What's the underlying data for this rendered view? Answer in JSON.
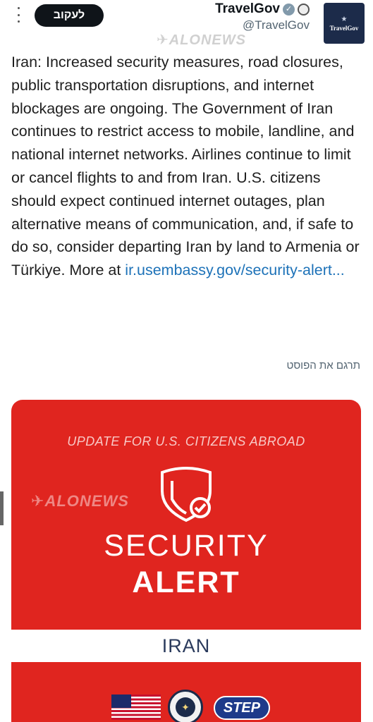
{
  "header": {
    "follow_label": "לעקוב",
    "display_name": "TravelGov",
    "handle": "@TravelGov",
    "avatar_label": "TravelGov",
    "avatar_star": "★"
  },
  "watermark": "ALONEWS",
  "tweet": {
    "body": "Iran: Increased security measures, road closures, public transportation disruptions, and internet blockages are ongoing. The Government of Iran continues to restrict access to mobile, landline, and national internet networks. Airlines continue to limit or cancel flights to and from Iran. U.S. citizens should expect continued internet outages, plan alternative means of communication, and, if safe to do so, consider departing Iran by land to Armenia or Türkiye. More at ",
    "link": "ir.usembassy.gov/security-alert...",
    "translate_label": "תרגם את הפוסט"
  },
  "card": {
    "subtitle": "UPDATE FOR U.S. CITIZENS ABROAD",
    "watermark": "ALONEWS",
    "title_line1": "SECURITY",
    "title_line2": "ALERT",
    "country": "IRAN",
    "step_label": "STEP",
    "seal_glyph": "✦",
    "colors": {
      "card_red": "#e0251f",
      "navy": "#1c2b4a"
    }
  },
  "icons": [
    "menu-dots-icon",
    "verified-badge-icon",
    "affiliate-badge-icon",
    "shield-check-icon",
    "us-flag-icon",
    "state-dept-seal-icon",
    "plane-icon"
  ]
}
